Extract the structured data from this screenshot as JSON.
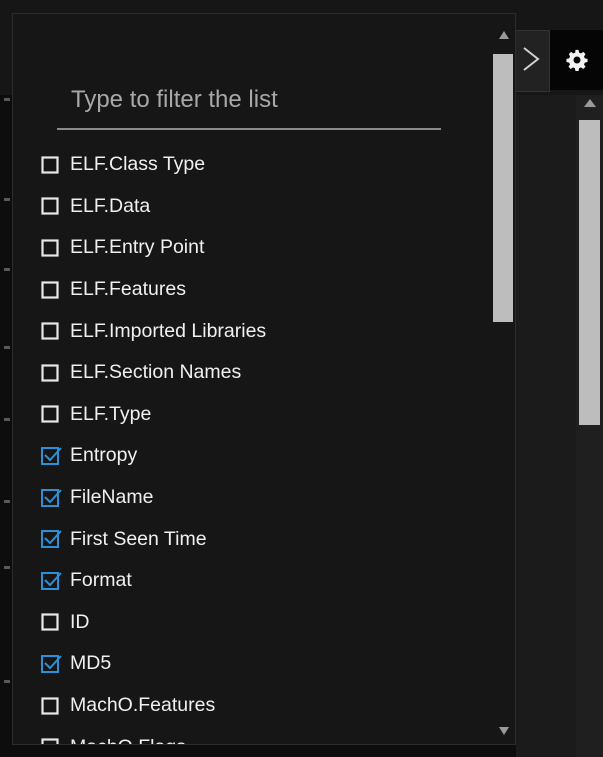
{
  "filter": {
    "placeholder": "Type to filter the list",
    "value": ""
  },
  "columns": [
    {
      "label": "ELF.Class Type",
      "checked": false
    },
    {
      "label": "ELF.Data",
      "checked": false
    },
    {
      "label": "ELF.Entry Point",
      "checked": false
    },
    {
      "label": "ELF.Features",
      "checked": false
    },
    {
      "label": "ELF.Imported Libraries",
      "checked": false
    },
    {
      "label": "ELF.Section Names",
      "checked": false
    },
    {
      "label": "ELF.Type",
      "checked": false
    },
    {
      "label": "Entropy",
      "checked": true
    },
    {
      "label": "FileName",
      "checked": true
    },
    {
      "label": "First Seen Time",
      "checked": true
    },
    {
      "label": "Format",
      "checked": true
    },
    {
      "label": "ID",
      "checked": false
    },
    {
      "label": "MD5",
      "checked": true
    },
    {
      "label": "MachO.Features",
      "checked": false
    },
    {
      "label": "MachO.Flags",
      "checked": false
    }
  ],
  "icons": {
    "settings": "gear-icon",
    "expand": "chevron-right-icon",
    "scroll_up": "triangle-up-icon",
    "scroll_down": "triangle-down-icon"
  },
  "colors": {
    "checked": "#2d8fd5",
    "unchecked": "#e8e8e8",
    "panel_bg": "#161616"
  }
}
